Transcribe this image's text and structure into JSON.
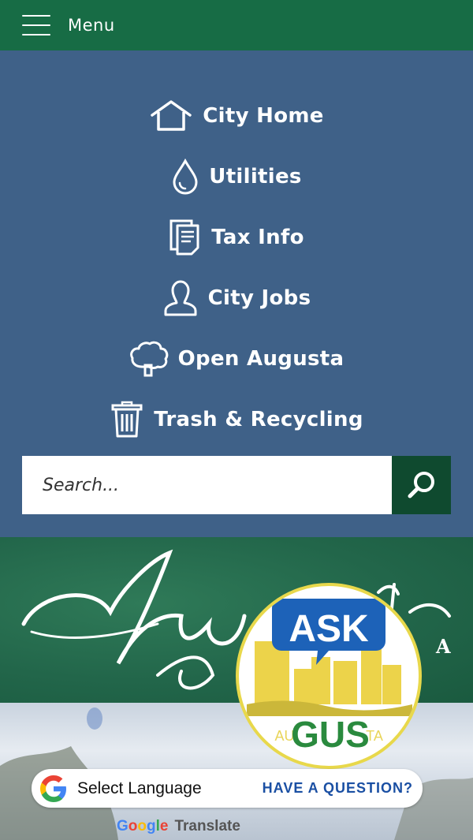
{
  "header": {
    "menu_label": "Menu",
    "bg_color": "#176c45"
  },
  "nav": {
    "bg_color": "#3f6188",
    "items": [
      {
        "label": "City Home",
        "icon": "house-icon"
      },
      {
        "label": "Utilities",
        "icon": "water-drop-icon"
      },
      {
        "label": "Tax Info",
        "icon": "document-icon"
      },
      {
        "label": "City Jobs",
        "icon": "person-icon"
      },
      {
        "label": "Open Augusta",
        "icon": "tree-icon"
      },
      {
        "label": "Trash & Recycling",
        "icon": "trash-can-icon"
      }
    ]
  },
  "search": {
    "placeholder": "Search...",
    "button_icon": "search-icon",
    "button_color": "#0f4a2f"
  },
  "banner": {
    "logo_text": "Augusta",
    "state_letter": "A"
  },
  "askgus": {
    "ask": "ASK",
    "au": "AU",
    "gus": "GUS",
    "ta": "TA",
    "tagline": "HAVE A QUESTION?"
  },
  "translate": {
    "select_label": "Select Language",
    "powered_g": [
      "G",
      "o",
      "o",
      "g",
      "l",
      "e"
    ],
    "powered_label": "Translate"
  }
}
